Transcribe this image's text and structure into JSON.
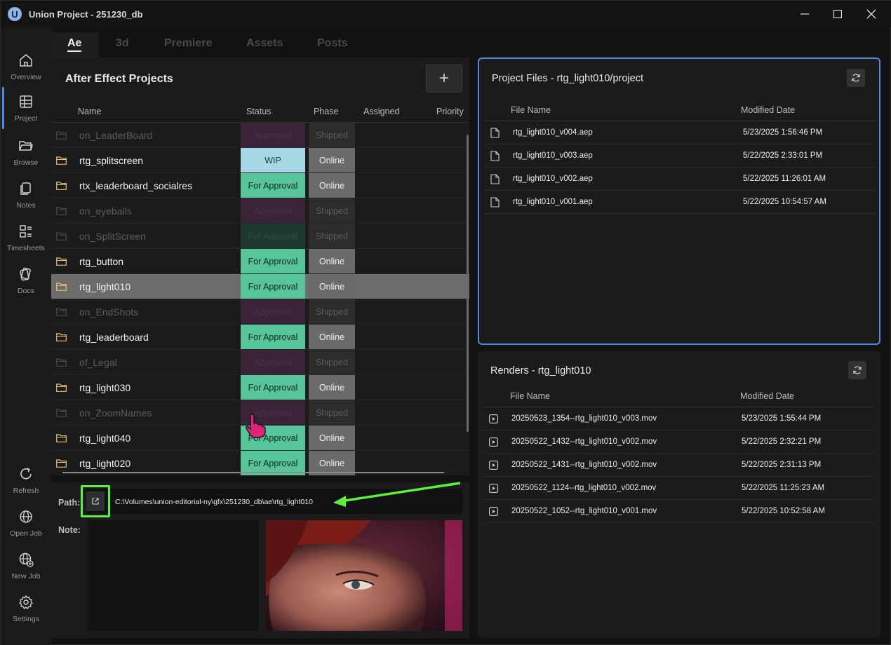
{
  "window": {
    "logo_letter": "U",
    "title": "Union Project - 251230_db"
  },
  "sidebar": {
    "items": [
      {
        "label": "Overview",
        "icon": "home-icon"
      },
      {
        "label": "Project",
        "icon": "table-icon",
        "active": true
      },
      {
        "label": "Browse",
        "icon": "folder-open-icon"
      },
      {
        "label": "Notes",
        "icon": "notes-icon"
      },
      {
        "label": "Timesheets",
        "icon": "timesheets-icon"
      },
      {
        "label": "Docs",
        "icon": "docs-icon"
      }
    ],
    "bottom_items": [
      {
        "label": "Refresh",
        "icon": "refresh-icon"
      },
      {
        "label": "Open Job",
        "icon": "globe-icon"
      },
      {
        "label": "New Job",
        "icon": "globe-plus-icon"
      },
      {
        "label": "Settings",
        "icon": "gear-icon"
      }
    ]
  },
  "tabs": [
    "Ae",
    "3d",
    "Premiere",
    "Assets",
    "Posts"
  ],
  "projects": {
    "title": "After Effect Projects",
    "add_label": "+",
    "columns": [
      "Name",
      "Status",
      "Phase",
      "Assigned",
      "Priority"
    ],
    "rows": [
      {
        "name": "on_LeaderBoard",
        "status": "Approved",
        "phase": "Shipped"
      },
      {
        "name": "rtg_splitscreen",
        "status": "WIP",
        "phase": "Online"
      },
      {
        "name": "rtx_leaderboard_socialres",
        "status": "For Approval",
        "phase": "Online"
      },
      {
        "name": "on_eyeballs",
        "status": "Approved",
        "phase": "Shipped"
      },
      {
        "name": "on_SplitScreen",
        "status": "For Approval",
        "phase": "Shipped"
      },
      {
        "name": "rtg_button",
        "status": "For Approval",
        "phase": "Online"
      },
      {
        "name": "rtg_light010",
        "status": "For Approval",
        "phase": "Online"
      },
      {
        "name": "on_EndShots",
        "status": "Approved",
        "phase": "Shipped"
      },
      {
        "name": "rtg_leaderboard",
        "status": "For Approval",
        "phase": "Online"
      },
      {
        "name": "of_Legal",
        "status": "Approved",
        "phase": "Shipped"
      },
      {
        "name": "rtg_light030",
        "status": "For Approval",
        "phase": "Online"
      },
      {
        "name": "on_ZoomNames",
        "status": "Approved",
        "phase": "Shipped"
      },
      {
        "name": "rtg_light040",
        "status": "For Approval",
        "phase": "Online"
      },
      {
        "name": "rtg_light020",
        "status": "For Approval",
        "phase": "Online"
      }
    ]
  },
  "details": {
    "path_label": "Path:",
    "path_value": "C:\\Volumes\\union-editorial-ny\\gfx\\251230_db\\ae\\rtg_light010",
    "note_label": "Note:"
  },
  "project_files": {
    "title": "Project Files - rtg_light010/project",
    "columns": [
      "File Name",
      "Modified Date"
    ],
    "rows": [
      {
        "name": "rtg_light010_v004.aep",
        "date": "5/23/2025 1:56:46 PM"
      },
      {
        "name": "rtg_light010_v003.aep",
        "date": "5/22/2025 2:33:01 PM"
      },
      {
        "name": "rtg_light010_v002.aep",
        "date": "5/22/2025 11:26:01 AM"
      },
      {
        "name": "rtg_light010_v001.aep",
        "date": "5/22/2025 10:54:57 AM"
      }
    ]
  },
  "renders": {
    "title": "Renders - rtg_light010",
    "columns": [
      "File Name",
      "Modified Date"
    ],
    "rows": [
      {
        "name": "20250523_1354--rtg_light010_v003.mov",
        "date": "5/23/2025 1:55:44 PM"
      },
      {
        "name": "20250522_1432--rtg_light010_v002.mov",
        "date": "5/22/2025 2:32:21 PM"
      },
      {
        "name": "20250522_1431--rtg_light010_v002.mov",
        "date": "5/22/2025 2:31:13 PM"
      },
      {
        "name": "20250522_1124--rtg_light010_v002.mov",
        "date": "5/22/2025 11:25:23 AM"
      },
      {
        "name": "20250522_1052--rtg_light010_v001.mov",
        "date": "5/22/2025 10:52:58 AM"
      }
    ]
  },
  "colors": {
    "accent": "#4a90e2",
    "wip": "#a8d8e6",
    "for_approval": "#58c49a",
    "highlight": "#5ef03a",
    "cursor": "#e0247a"
  }
}
